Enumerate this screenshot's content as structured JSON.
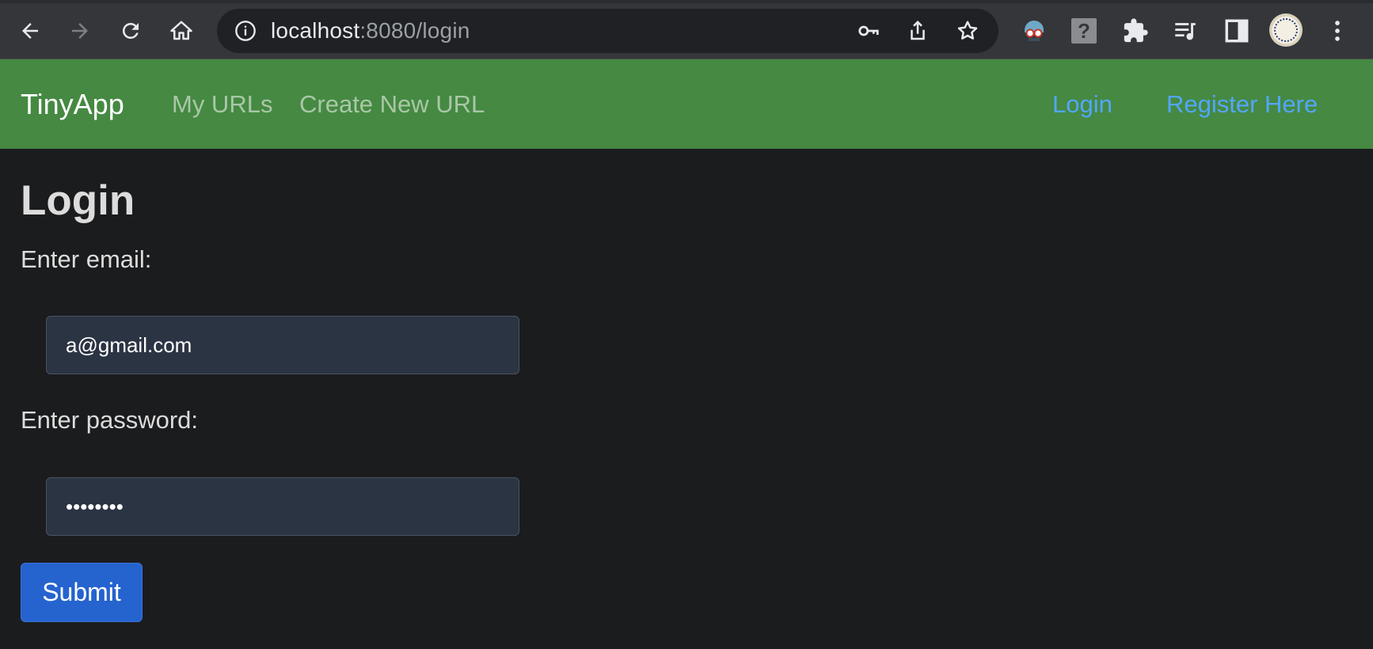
{
  "browser": {
    "url_host": "localhost",
    "url_rest": ":8080/login",
    "icons": [
      "back-arrow-icon",
      "forward-arrow-icon",
      "reload-icon",
      "home-icon",
      "site-info-icon",
      "key-icon",
      "share-icon",
      "star-icon",
      "extension-robot-icon",
      "extension-question-icon",
      "extensions-puzzle-icon",
      "media-queue-icon",
      "side-panel-icon",
      "profile-avatar",
      "more-menu-icon"
    ]
  },
  "navbar": {
    "brand": "TinyApp",
    "links": [
      "My URLs",
      "Create New URL"
    ],
    "login": "Login",
    "register": "Register Here",
    "background": "#458942"
  },
  "form": {
    "heading": "Login",
    "email_label": "Enter email:",
    "email_value": "a@gmail.com",
    "password_label": "Enter password:",
    "password_value": "••••••••",
    "submit_label": "Submit"
  },
  "colors": {
    "page_bg": "#1b1c1e",
    "link_blue": "#53a6ff",
    "button_blue": "#2563cf"
  }
}
